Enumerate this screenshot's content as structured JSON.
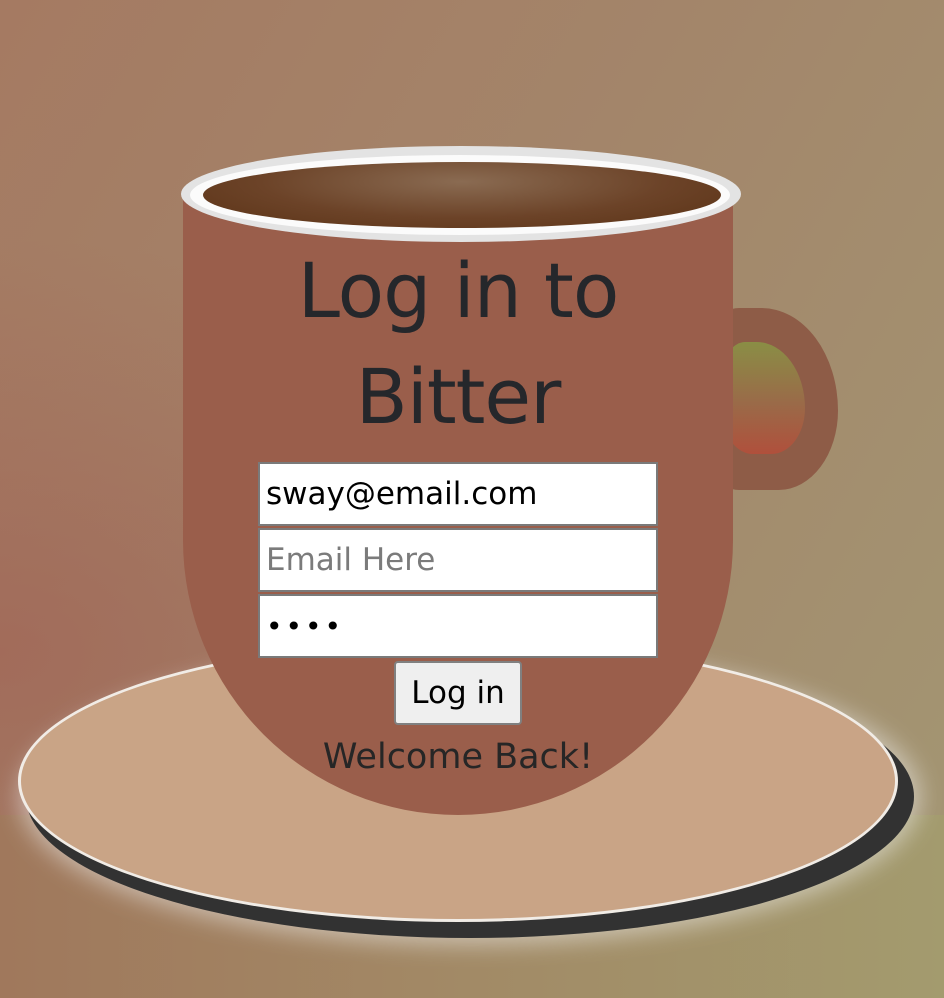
{
  "login": {
    "title": "Log in to Bitter",
    "email_value": "sway@email.com",
    "second_field_placeholder": "Email Here",
    "password_value": "••••",
    "button_label": "Log in",
    "status_message": "Welcome Back!"
  },
  "colors": {
    "cup": "#9a5e4b",
    "saucer": "#c9a486",
    "coffee": "#6c4328",
    "text": "#25272b"
  }
}
